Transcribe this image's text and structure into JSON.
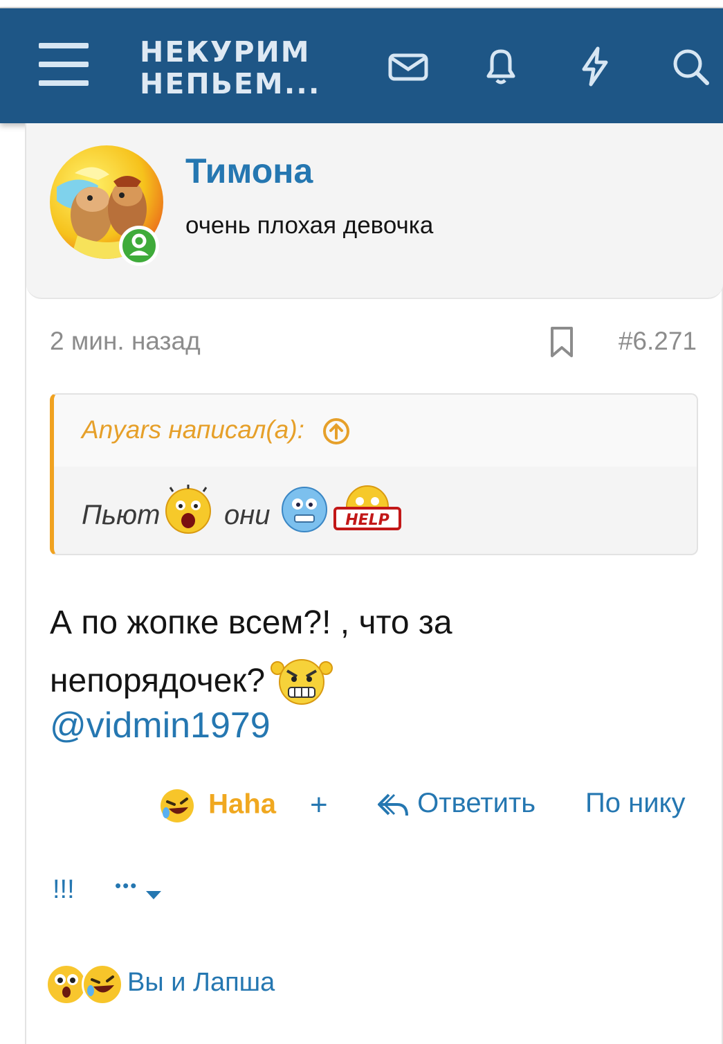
{
  "header": {
    "logo_line1": "НЕКУРИМ",
    "logo_line2": "НЕПЬЕМ...",
    "icons": [
      "menu-icon",
      "envelope-icon",
      "bell-icon",
      "lightning-icon",
      "search-icon"
    ],
    "background": "#1e5686"
  },
  "post": {
    "username": "Тимона",
    "user_title": "очень плохая девочка",
    "time": "2 мин. назад",
    "post_number": "#6.271",
    "quote": {
      "author_line": "Anyars написал(а):",
      "text_part1": "Пьют",
      "text_part2": "они",
      "help_sign": "HELP"
    },
    "message_line1": "А по жопке всем?! , что за",
    "message_line2": "непорядочек?",
    "mention": "@vidmin1979",
    "actions": {
      "haha": "Haha",
      "plus": "+",
      "reply": "Ответить",
      "by_nick": "По нику",
      "exclaim": "!!!",
      "more": "•••"
    },
    "reactions_text": "Вы и Лапша"
  },
  "colors": {
    "accent_blue": "#2577b1",
    "quote_orange": "#f0a220",
    "online_green": "#3fab3a"
  }
}
